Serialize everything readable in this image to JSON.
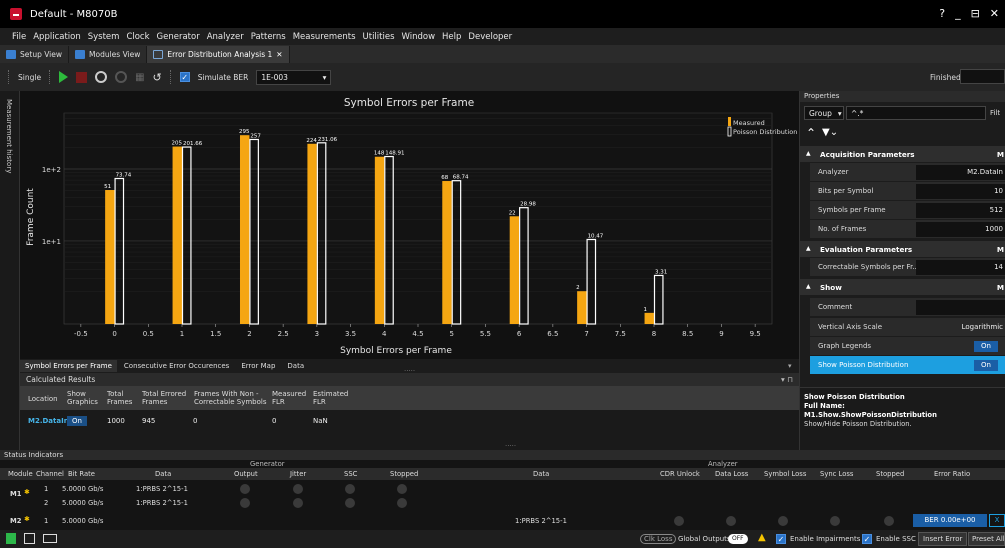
{
  "window": {
    "title": "Default - M8070B",
    "controls": [
      "?",
      "_",
      "⊟",
      "✕"
    ]
  },
  "menu": [
    "File",
    "Application",
    "System",
    "Clock",
    "Generator",
    "Analyzer",
    "Patterns",
    "Measurements",
    "Utilities",
    "Window",
    "Help",
    "Developer"
  ],
  "tabs": [
    {
      "label": "Setup View"
    },
    {
      "label": "Modules View"
    },
    {
      "label": "Error Distribution Analysis 1"
    }
  ],
  "toolbar": {
    "single_label": "Single",
    "simulate_label": "Simulate BER",
    "ber_value": "1E-003",
    "status": "Finished"
  },
  "sidestrip": {
    "label": "Measurement history"
  },
  "chart_data": {
    "type": "bar",
    "title": "Symbol Errors per Frame",
    "xlabel": "Symbol Errors per Frame",
    "ylabel": "Frame Count",
    "yscale": "log",
    "ylim": [
      0.7,
      600
    ],
    "xlim": [
      -0.75,
      9.75
    ],
    "x_ticks": [
      "-0.5",
      "0",
      "0.5",
      "1",
      "1.5",
      "2",
      "2.5",
      "3",
      "3.5",
      "4",
      "4.5",
      "5",
      "5.5",
      "6",
      "6.5",
      "7",
      "7.5",
      "8",
      "8.5",
      "9",
      "9.5"
    ],
    "y_ticks": [
      "1e+2",
      "1e+1"
    ],
    "legend": [
      "Measured",
      "Poisson Distribution"
    ],
    "legend_position": "top-right",
    "x": [
      0,
      1,
      2,
      3,
      4,
      5,
      6,
      7,
      8
    ],
    "series": [
      {
        "name": "Measured",
        "color": "#f5a612",
        "values": [
          51,
          205,
          295,
          224,
          148,
          68,
          22,
          2,
          1
        ],
        "labels": [
          "51",
          "205",
          "295",
          "224",
          "148",
          "68",
          "22",
          "2",
          "1"
        ]
      },
      {
        "name": "Poisson Distribution",
        "color": "#ffffff",
        "values": [
          73.74,
          201.66,
          257,
          231.06,
          148.91,
          68.74,
          28.98,
          10.47,
          3.31
        ],
        "labels": [
          "73.74",
          "201.66",
          "257",
          "231.06",
          "148.91",
          "68.74",
          "28.98",
          "10.47",
          "3.31"
        ]
      }
    ]
  },
  "chart_tabs": [
    "Symbol Errors per Frame",
    "Consecutive Error Occurences",
    "Error Map",
    "Data"
  ],
  "results": {
    "title": "Calculated Results",
    "headers": [
      "Location",
      "Show Graphics",
      "Total Frames",
      "Total Errored Frames",
      "Frames With Non -Correctable Symbols",
      "Measured FLR",
      "Estimated FLR"
    ],
    "row": {
      "location": "M2.DataIn",
      "show": "On",
      "total_frames": "1000",
      "errored_frames": "945",
      "non_correctable": "0",
      "measured_flr": "0",
      "estimated_flr": "NaN"
    }
  },
  "properties": {
    "title": "Properties",
    "group_label": "Group",
    "filter_value": "^.*",
    "filter_label": "Filt",
    "sections": [
      {
        "name": "Acquisition Parameters",
        "tag": "M",
        "rows": [
          {
            "label": "Analyzer",
            "value": "M2.DataIn"
          },
          {
            "label": "Bits per Symbol",
            "value": "10"
          },
          {
            "label": "Symbols per Frame",
            "value": "512"
          },
          {
            "label": "No. of Frames",
            "value": "1000"
          }
        ]
      },
      {
        "name": "Evaluation Parameters",
        "tag": "M",
        "rows": [
          {
            "label": "Correctable Symbols per Fr...",
            "value": "14"
          }
        ]
      },
      {
        "name": "Show",
        "tag": "M",
        "rows": [
          {
            "label": "Comment",
            "value": ""
          },
          {
            "label": "Vertical Axis Scale",
            "value": "Logarithmic"
          },
          {
            "label": "Graph Legends",
            "value": "On"
          },
          {
            "label": "Show Poisson Distribution",
            "value": "On"
          }
        ]
      }
    ],
    "help": {
      "title": "Show Poisson Distribution",
      "fullname_label": "Full Name:",
      "fullname": "M1.Show.ShowPoissonDistribution",
      "desc": "Show/Hide Poisson Distribution."
    }
  },
  "status": {
    "title": "Status Indicators",
    "gen_label": "Generator",
    "ana_label": "Analyzer",
    "cols": {
      "module": "Module",
      "channel": "Channel",
      "bitrate": "Bit Rate",
      "data": "Data",
      "output": "Output",
      "jitter": "Jitter",
      "ssc": "SSC",
      "stopped": "Stopped",
      "adata": "Data",
      "cdr": "CDR Unlock",
      "dloss": "Data Loss",
      "sloss": "Symbol Loss",
      "syncloss": "Sync Loss",
      "astopped": "Stopped",
      "er": "Error Ratio"
    },
    "rows": [
      {
        "module": "M1",
        "channel": "1",
        "bitrate": "5.0000 Gb/s",
        "data": "1:PRBS 2^15-1"
      },
      {
        "module": "",
        "channel": "2",
        "bitrate": "5.0000 Gb/s",
        "data": "1:PRBS 2^15-1"
      },
      {
        "module": "M2",
        "channel": "1",
        "bitrate": "5.0000 Gb/s",
        "adata": "1:PRBS 2^15-1",
        "ber": "BER 0.00e+00"
      }
    ]
  },
  "bottom": {
    "clk_loss": "Clk Loss",
    "global_outputs": "Global Outputs",
    "off": "OFF",
    "enable_impairments": "Enable Impairments",
    "enable_ssc": "Enable SSC",
    "insert_error": "Insert Error",
    "preset_all": "Preset All"
  }
}
